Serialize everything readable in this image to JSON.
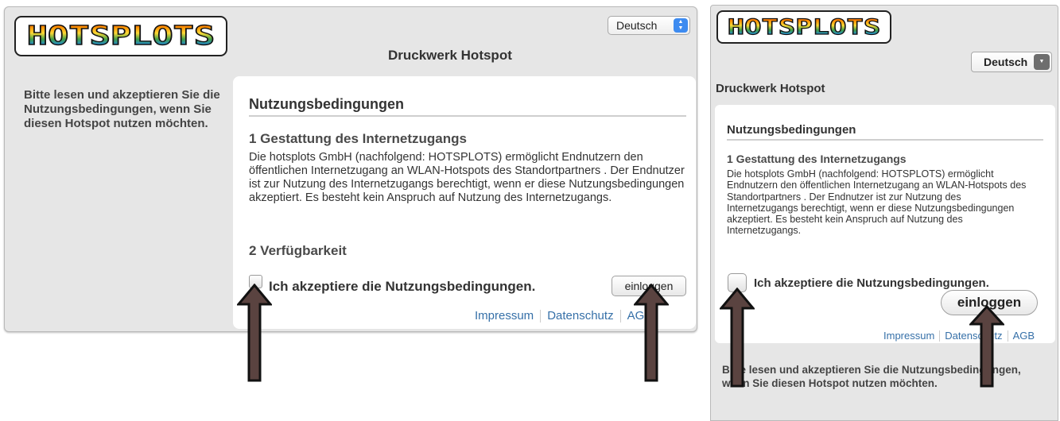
{
  "desktop": {
    "logo_text": "HOTSPLOTS",
    "language": {
      "selected": "Deutsch"
    },
    "title": "Druckwerk Hotspot",
    "info_text": "Bitte lesen und akzeptieren Sie die Nutzungsbedingungen, wenn Sie diesen Hotspot nutzen möchten.",
    "terms": {
      "heading": "Nutzungsbedingungen",
      "section1_title": "1 Gestattung des Internetzugangs",
      "section1_body": "Die hotsplots GmbH (nachfolgend: HOTSPLOTS) ermöglicht Endnutzern den öffentlichen Internetzugang an WLAN-Hotspots des Standortpartners . Der Endnutzer ist zur Nutzung des Internetzugangs berechtigt, wenn er diese Nutzungsbedingungen akzeptiert. Es besteht kein Anspruch auf Nutzung des Internetzugangs.",
      "section2_title": "2 Verfügbarkeit"
    },
    "accept_label": "Ich akzeptiere die Nutzungsbedingungen.",
    "login_button": "einloggen",
    "footer_links": [
      "Impressum",
      "Datenschutz",
      "AGB"
    ]
  },
  "mobile": {
    "logo_text": "HOTSPLOTS",
    "language": {
      "selected": "Deutsch"
    },
    "title": "Druckwerk Hotspot",
    "terms": {
      "heading": "Nutzungsbedingungen",
      "section1_title": "1 Gestattung des Internetzugangs",
      "section1_body": "Die hotsplots GmbH (nachfolgend: HOTSPLOTS) ermöglicht Endnutzern den öffentlichen Internetzugang an WLAN-Hotspots des Standortpartners . Der Endnutzer ist zur Nutzung des Internetzugangs berechtigt, wenn er diese Nutzungsbedingungen akzeptiert. Es besteht kein Anspruch auf Nutzung des Internetzugangs."
    },
    "accept_label": "Ich akzeptiere die Nutzungsbedingungen.",
    "login_button": "einloggen",
    "footer_links": [
      "Impressum",
      "Datenschutz",
      "AGB"
    ],
    "info_text": "Bitte lesen und akzeptieren Sie die Nutzungsbedingungen, wenn Sie diesen Hotspot nutzen möchten."
  },
  "annotation_arrows": [
    {
      "name": "arrow-to-checkbox-desktop",
      "color": "#5a4340"
    },
    {
      "name": "arrow-to-login-desktop",
      "color": "#5a4340"
    },
    {
      "name": "arrow-to-checkbox-mobile",
      "color": "#5a4340"
    },
    {
      "name": "arrow-to-login-mobile",
      "color": "#5a4340"
    }
  ],
  "colors": {
    "background": "#e6e6e6",
    "card": "#ffffff",
    "link": "#3670a8",
    "select_caret_desktop": "#3d8bf0",
    "select_caret_mobile": "#6e6e6e"
  },
  "icons": {
    "logo": "hotsplots-logo",
    "language_caret": "chevron-updown-icon",
    "checkbox": "checkbox-unchecked"
  }
}
